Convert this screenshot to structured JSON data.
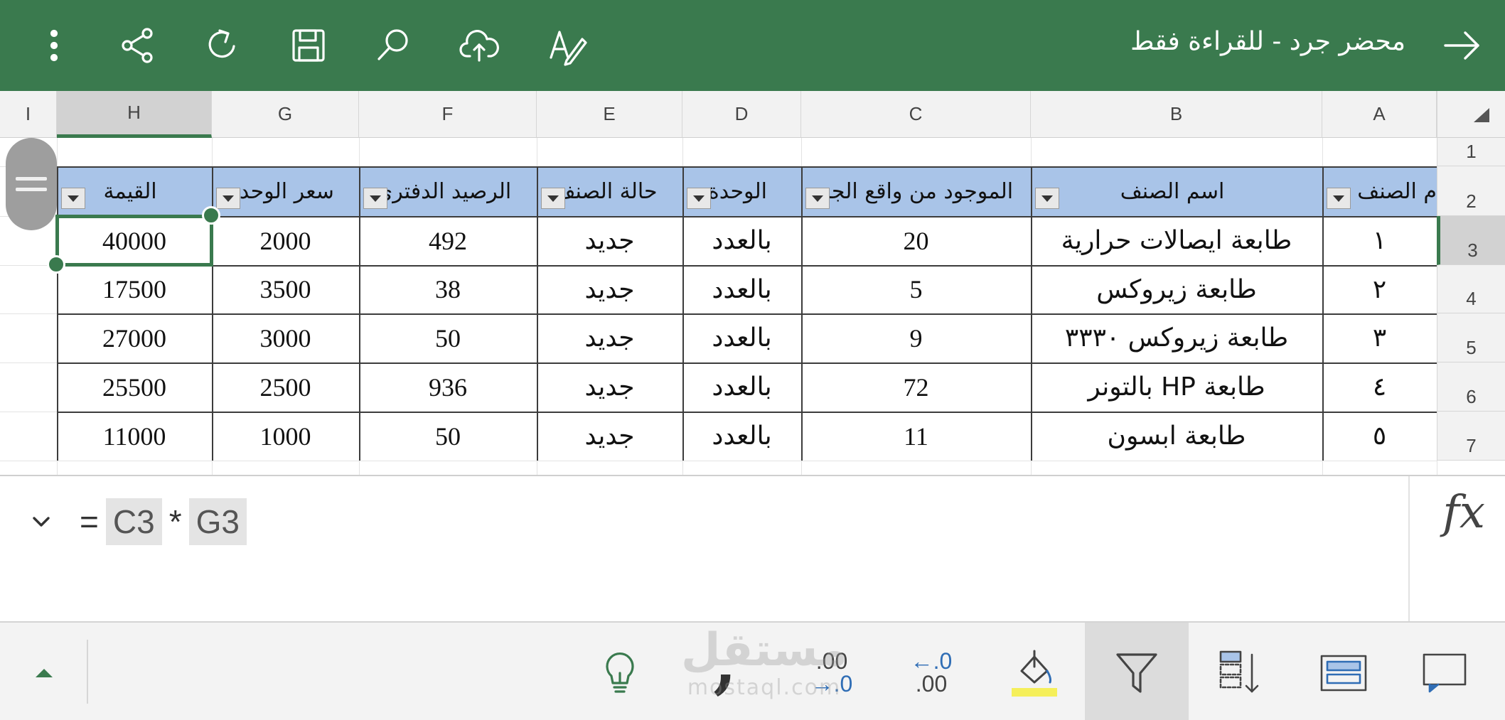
{
  "app": {
    "title": "محضر جرد - للقراءة فقط",
    "accent": "#3a7a4e",
    "toolbar_icons": [
      "more-vertical-icon",
      "share-icon",
      "redo-icon",
      "save-icon",
      "search-icon",
      "upload-cloud-icon",
      "draw-icon"
    ]
  },
  "grid": {
    "columns": [
      "A",
      "B",
      "C",
      "D",
      "E",
      "F",
      "G",
      "H",
      "I"
    ],
    "selected_column": "H",
    "rows": [
      "1",
      "2",
      "3",
      "4",
      "5",
      "6",
      "7"
    ],
    "selected_row": "3",
    "header_fill": "#a9c4e8",
    "headers": {
      "A": "م الصنف",
      "B": "اسم الصنف",
      "C": "الموجود من واقع الجرد",
      "D": "الوحدة",
      "E": "حالة الصنف",
      "F": "الرصيد الدفتري",
      "G": "سعر الوحده",
      "H": "القيمة"
    },
    "data_rows": [
      {
        "row": "3",
        "A": "١",
        "B": "طابعة ايصالات حرارية",
        "C": "20",
        "D": "بالعدد",
        "E": "جديد",
        "F": "492",
        "G": "2000",
        "H": "40000"
      },
      {
        "row": "4",
        "A": "٢",
        "B": "طابعة زيروكس",
        "C": "5",
        "D": "بالعدد",
        "E": "جديد",
        "F": "38",
        "G": "3500",
        "H": "17500"
      },
      {
        "row": "5",
        "A": "٣",
        "B": "طابعة زيروكس ٣٣٣٠",
        "C": "9",
        "D": "بالعدد",
        "E": "جديد",
        "F": "50",
        "G": "3000",
        "H": "27000"
      },
      {
        "row": "6",
        "A": "٤",
        "B": "طابعة HP بالتونر",
        "C": "72",
        "D": "بالعدد",
        "E": "جديد",
        "F": "936",
        "G": "2500",
        "H": "25500"
      },
      {
        "row": "7",
        "A": "٥",
        "B": "طابعة ابسون",
        "C": "11",
        "D": "بالعدد",
        "E": "جديد",
        "F": "50",
        "G": "1000",
        "H": "11000"
      }
    ]
  },
  "formula": {
    "equals": "=",
    "ref1": "C3",
    "operator": "*",
    "ref2": "G3",
    "fx_label": "fx"
  },
  "toolbar": {
    "expand_icon": "caret-up-icon",
    "comma_glyph": ",",
    "dec_increase_top": ".00",
    "dec_increase_bottom": "→.0",
    "dec_decrease_top": "←.0",
    "dec_decrease_bottom": ".00",
    "fill_highlight": "#f5ef5a",
    "watermark_line1": "مستقل",
    "watermark_line2": "mostaql.com"
  }
}
